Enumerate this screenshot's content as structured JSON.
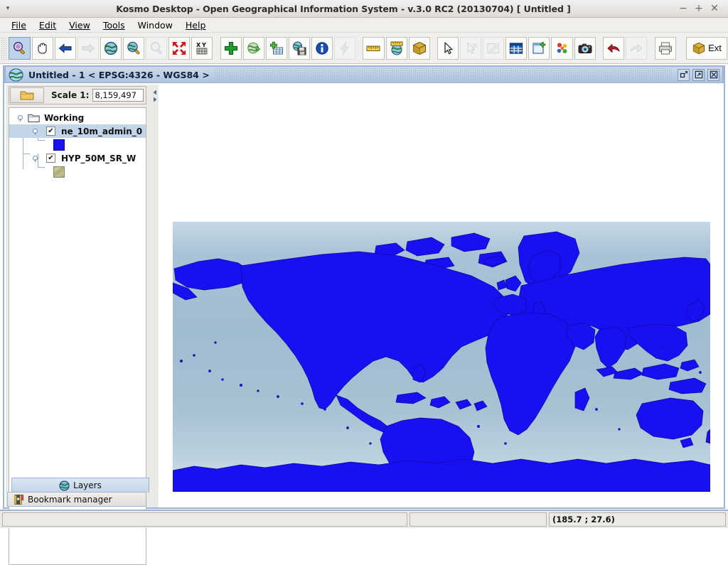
{
  "window": {
    "title": "Kosmo Desktop - Open Geographical Information System - v.3.0 RC2 (20130704)  [ Untitled ]",
    "menu_arrow": "▾",
    "minimize": "−",
    "maximize": "+",
    "close": "✕"
  },
  "menubar": [
    {
      "label": "File",
      "mnemonic": "F"
    },
    {
      "label": "Edit",
      "mnemonic": "E"
    },
    {
      "label": "View",
      "mnemonic": "V"
    },
    {
      "label": "Tools",
      "mnemonic": "T"
    },
    {
      "label": "Window",
      "mnemonic": "W"
    },
    {
      "label": "Help",
      "mnemonic": "H"
    }
  ],
  "toolbar": {
    "buttons": [
      {
        "name": "zoom-in-tool",
        "icon": "magnifier-purple",
        "state": "selected"
      },
      {
        "name": "pan-tool",
        "icon": "hand",
        "state": "normal"
      },
      {
        "name": "previous-extent",
        "icon": "arrow-left-blue",
        "state": "normal"
      },
      {
        "name": "next-extent",
        "icon": "arrow-right-gray",
        "state": "disabled"
      },
      {
        "name": "zoom-full-extent",
        "icon": "globe",
        "state": "normal"
      },
      {
        "name": "zoom-to-layer",
        "icon": "globe-magnifier",
        "state": "normal"
      },
      {
        "name": "zoom-to-selection",
        "icon": "magnifier-gray",
        "state": "disabled"
      },
      {
        "name": "zoom-to-features",
        "icon": "red-arrows-in",
        "state": "normal"
      },
      {
        "name": "goto-xy",
        "icon": "xy-coordinate",
        "state": "normal"
      },
      {
        "name": "add-layer",
        "icon": "green-plus",
        "state": "normal"
      },
      {
        "name": "add-wms-layer",
        "icon": "globe-plus",
        "state": "normal"
      },
      {
        "name": "add-table-layer",
        "icon": "table-plus",
        "state": "normal"
      },
      {
        "name": "save-view",
        "icon": "globe-floppy",
        "state": "normal"
      },
      {
        "name": "layer-info",
        "icon": "info-blue",
        "state": "normal"
      },
      {
        "name": "quick-query",
        "icon": "lightning-gray",
        "state": "disabled"
      },
      {
        "name": "measure-distance",
        "icon": "ruler",
        "state": "normal"
      },
      {
        "name": "measure-geodesic",
        "icon": "globe-ruler",
        "state": "normal"
      },
      {
        "name": "package-tool",
        "icon": "gold-box",
        "state": "normal"
      },
      {
        "name": "select-tool",
        "icon": "cursor-arrow",
        "state": "normal"
      },
      {
        "name": "deselect-tool",
        "icon": "cursor-deselect",
        "state": "disabled"
      },
      {
        "name": "edit-feature",
        "icon": "pencil-frame",
        "state": "disabled"
      },
      {
        "name": "attribute-table",
        "icon": "blue-grid",
        "state": "normal"
      },
      {
        "name": "new-view",
        "icon": "new-window-plus",
        "state": "normal"
      },
      {
        "name": "symbology",
        "icon": "color-dots",
        "state": "normal"
      },
      {
        "name": "screenshot",
        "icon": "camera",
        "state": "normal"
      },
      {
        "name": "undo",
        "icon": "undo-red",
        "state": "normal"
      },
      {
        "name": "redo",
        "icon": "redo-gray",
        "state": "disabled"
      },
      {
        "name": "print",
        "icon": "printer",
        "state": "normal"
      }
    ],
    "extensions_label": "Ext"
  },
  "frame": {
    "title": "Untitled - 1 < EPSG:4326 - WGS84 >",
    "restore_glyph": "❐",
    "maximize_glyph": "⤢",
    "close_glyph": "✕"
  },
  "left_panel": {
    "scale": {
      "label": "Scale 1:",
      "value": "8,159,497",
      "folder_icon": "folder-icon"
    },
    "tree": {
      "root": {
        "label": "Working",
        "icon": "folder-open-icon"
      },
      "layers": [
        {
          "label": "ne_10m_admin_0",
          "checked": true,
          "selected": true,
          "symbol": "polygon-blue"
        },
        {
          "label": "HYP_50M_SR_W",
          "checked": true,
          "selected": false,
          "symbol": "raster-thumb"
        }
      ],
      "check_glyph": "✔"
    },
    "tabs": [
      {
        "label": "Layers",
        "icon": "globe-icon",
        "active": true
      },
      {
        "label": "Bookmark manager",
        "icon": "bookmark-icon",
        "active": false
      }
    ]
  },
  "splitter": {
    "collapse_left_glyph": "◀",
    "collapse_right_glyph": "▶"
  },
  "map": {
    "ocean_color": "#a8c0d4",
    "land_color": "#1810f0",
    "border_color": "#0d0a9c",
    "background": "#ffffff"
  },
  "statusbar": {
    "left_message": "",
    "middle_message": "",
    "coordinates": "(185.7 ; 27.6)"
  }
}
